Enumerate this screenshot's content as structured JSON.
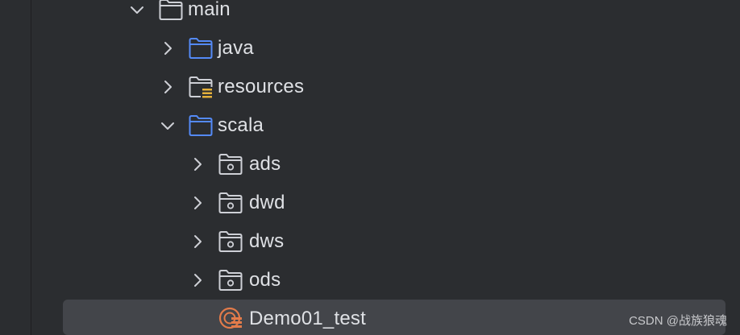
{
  "tree": {
    "items": [
      {
        "label": "main",
        "expanded": true,
        "icon": "folder-icon"
      },
      {
        "label": "java",
        "expanded": false,
        "icon": "source-folder-icon"
      },
      {
        "label": "resources",
        "expanded": false,
        "icon": "resources-folder-icon"
      },
      {
        "label": "scala",
        "expanded": true,
        "icon": "source-folder-icon"
      },
      {
        "label": "ads",
        "expanded": false,
        "icon": "package-icon"
      },
      {
        "label": "dwd",
        "expanded": false,
        "icon": "package-icon"
      },
      {
        "label": "dws",
        "expanded": false,
        "icon": "package-icon"
      },
      {
        "label": "ods",
        "expanded": false,
        "icon": "package-icon"
      },
      {
        "label": "Demo01_test",
        "selected": true,
        "icon": "scala-object-icon"
      }
    ]
  },
  "watermark": "CSDN @战族狼魂",
  "colors": {
    "background": "#2b2d30",
    "selection": "#43454a",
    "text": "#dfe1e5",
    "folder_outline": "#ced0d6",
    "source_folder": "#548af7",
    "resources_badge": "#e5b13b",
    "scala_icon": "#e37b4a"
  }
}
